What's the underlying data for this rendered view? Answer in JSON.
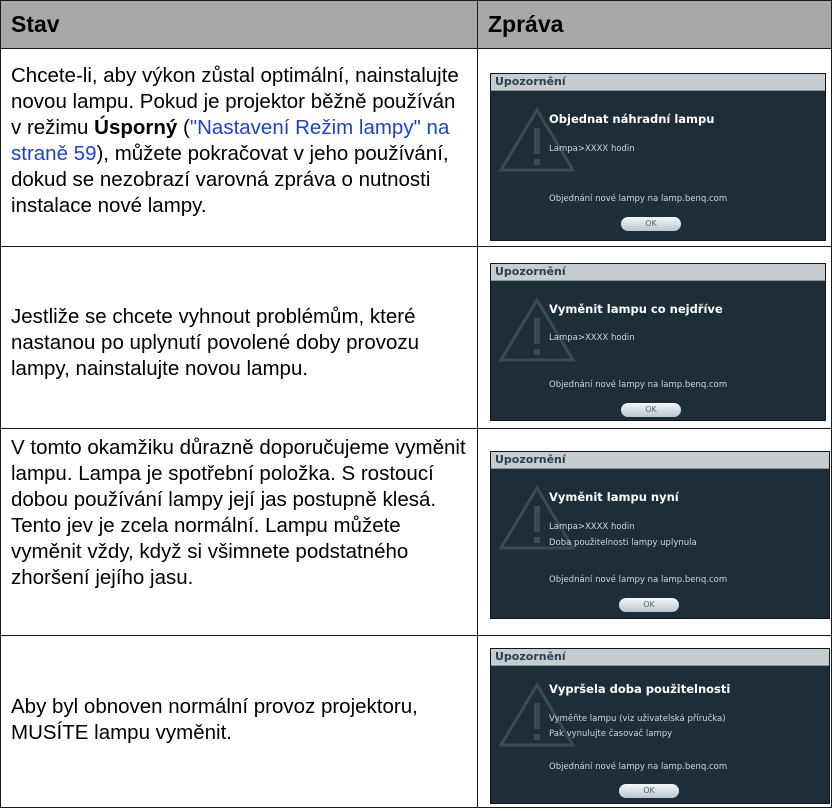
{
  "header": {
    "col_status": "Stav",
    "col_message": "Zpráva"
  },
  "rows": [
    {
      "text_before": "Chcete-li, aby výkon zůstal optimální, nainstalujte novou lampu. Pokud je projektor běžně používán v režimu ",
      "bold": "Úsporný",
      "text_mid": " (",
      "link": "\"Nastavení Režim lampy\" na straně 59",
      "text_after": "), můžete pokračovat v jeho používání, dokud se nezobrazí varovná zpráva o nutnosti instalace nové lampy.",
      "dialog": {
        "bar": "Upozornění",
        "title": "Objednat náhradní lampu",
        "lines": [
          "Lampa>XXXX hodin"
        ],
        "order": "Objednání nové lampy na lamp.benq.com",
        "ok": "OK"
      }
    },
    {
      "text": "Jestliže se chcete vyhnout problémům, které nastanou po uplynutí povolené doby provozu lampy, nainstalujte novou lampu.",
      "dialog": {
        "bar": "Upozornění",
        "title": "Vyměnit lampu co nejdříve",
        "lines": [
          "Lampa>XXXX hodin"
        ],
        "order": "Objednání nové lampy na lamp.benq.com",
        "ok": "OK"
      }
    },
    {
      "text": "V tomto okamžiku důrazně doporučujeme vyměnit lampu. Lampa je spotřební položka. S rostoucí dobou používání lampy její jas postupně klesá. Tento jev je zcela normální. Lampu můžete vyměnit vždy, když si všimnete podstatného zhoršení jejího jasu.",
      "dialog": {
        "bar": "Upozornění",
        "title": "Vyměnit lampu nyní",
        "lines": [
          "Lampa>XXXX hodin",
          "Doba použitelnosti lampy uplynula"
        ],
        "order": "Objednání nové lampy na lamp.benq.com",
        "ok": "OK"
      }
    },
    {
      "text": "Aby byl obnoven normální provoz projektoru, MUSÍTE lampu vyměnit.",
      "dialog": {
        "bar": "Upozornění",
        "title": "Vypršela doba použitelnosti",
        "lines": [
          "Vyměňte lampu (viz uživatelská příručka)",
          "Pak vynulujte časovač lampy"
        ],
        "order": "Objednání nové lampy na lamp.benq.com",
        "ok": "OK"
      }
    }
  ]
}
